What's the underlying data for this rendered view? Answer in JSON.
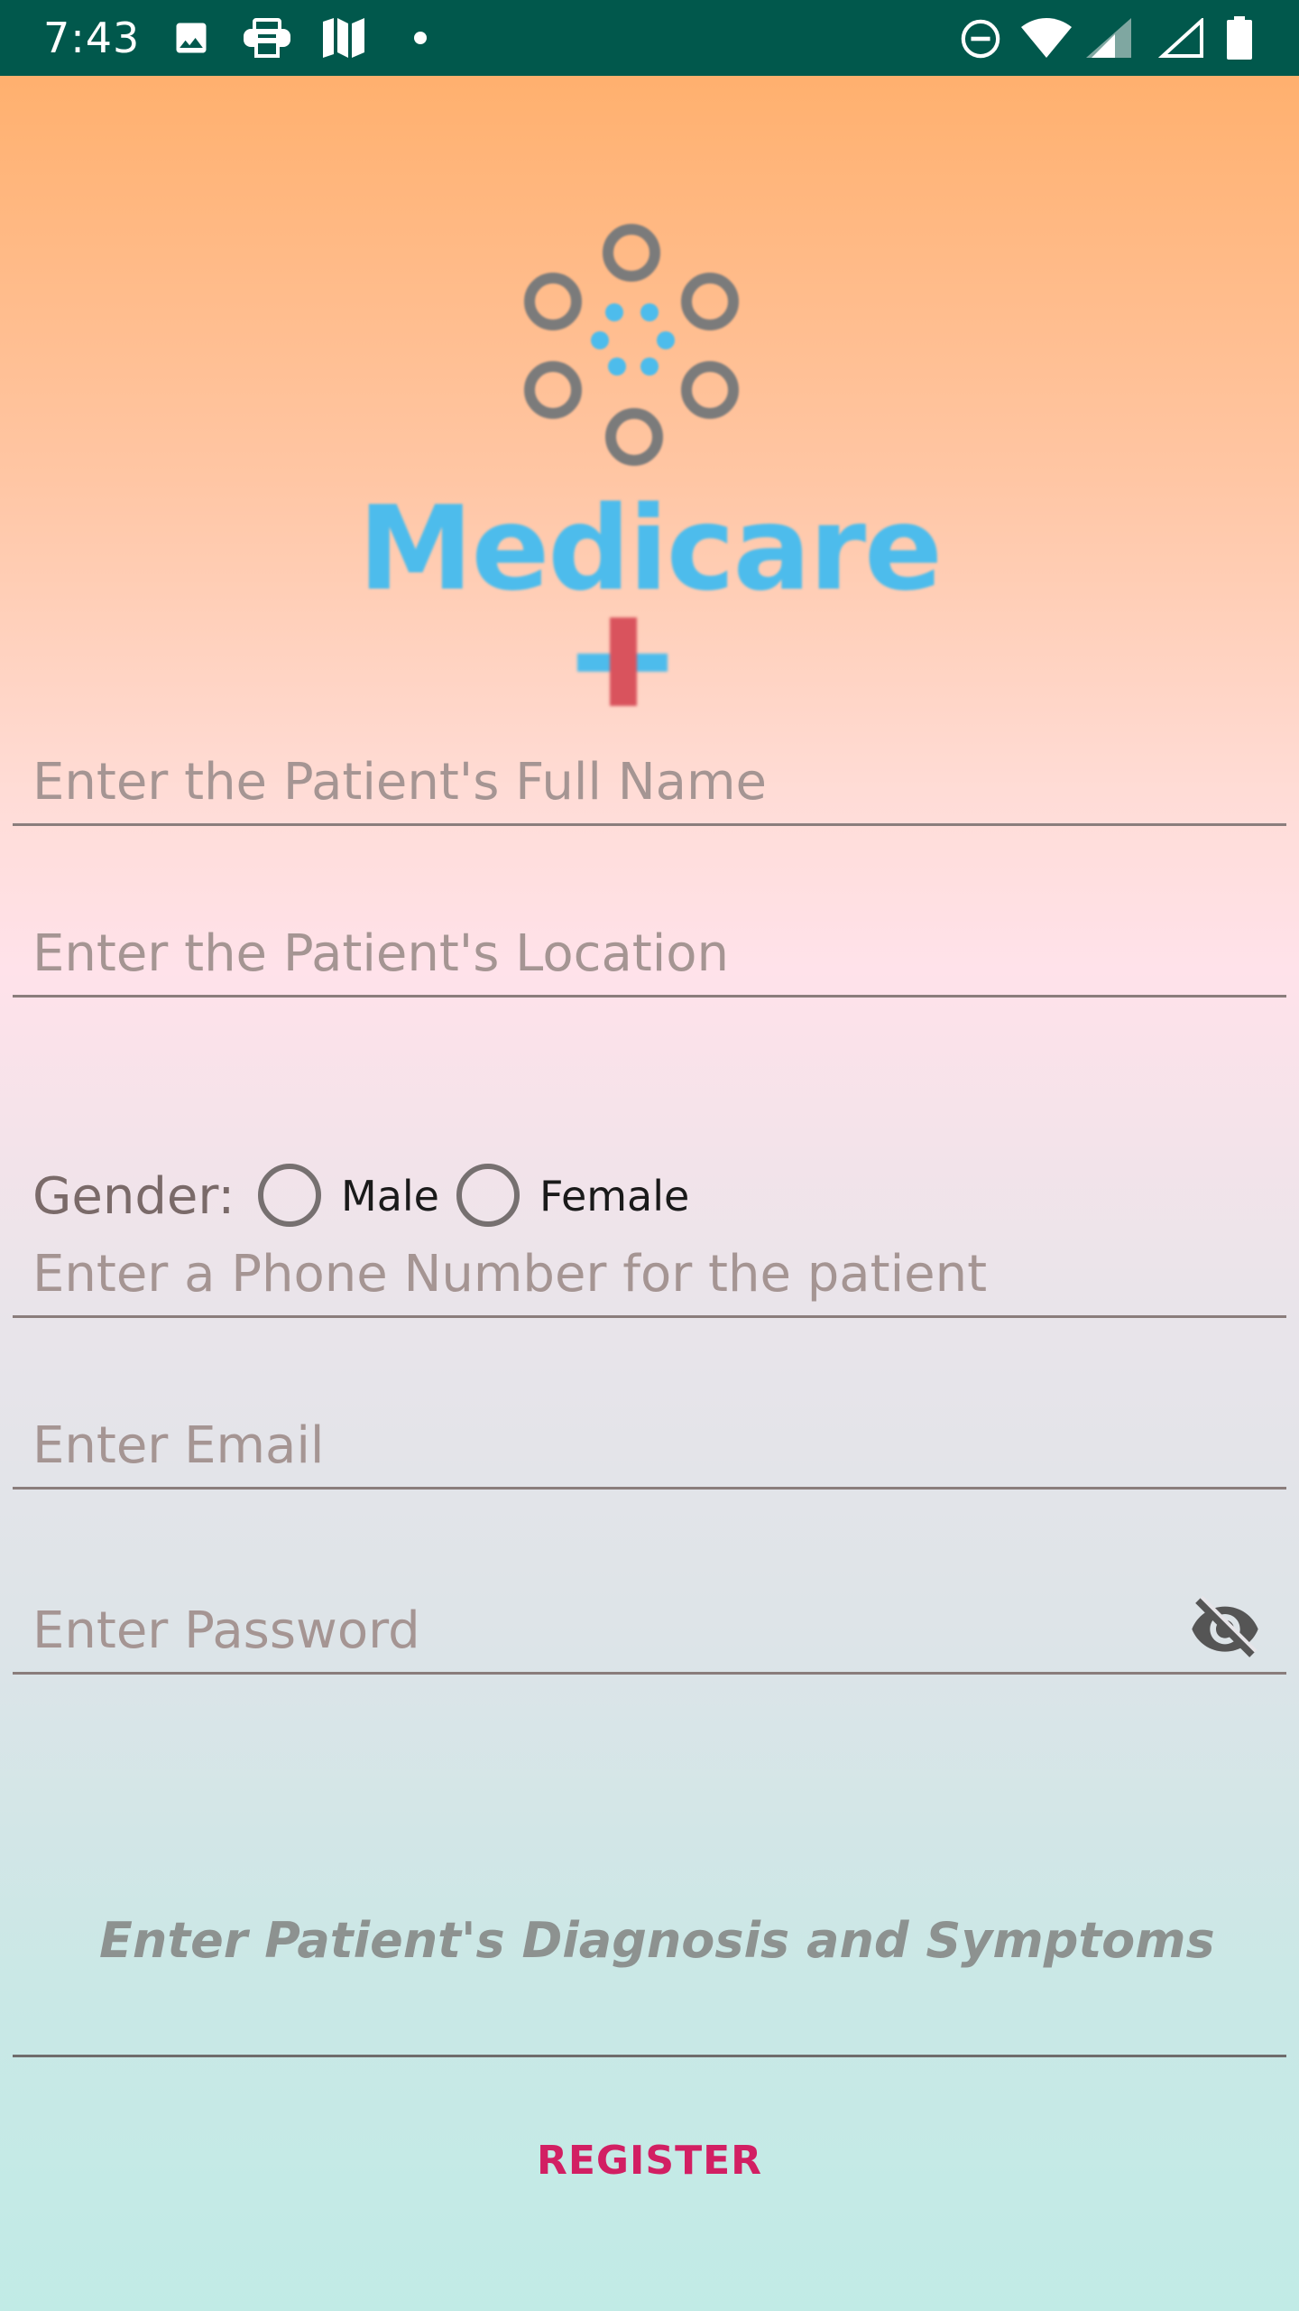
{
  "status_bar": {
    "time": "7:43",
    "icons": [
      "image-icon",
      "printer-icon",
      "maps-icon",
      "dot-icon",
      "do-not-disturb-icon",
      "wifi-icon",
      "signal-icon",
      "signal-empty-icon",
      "battery-icon"
    ]
  },
  "logo": {
    "wordmark": "Medicare",
    "colors": {
      "rings": "#7b7b7b",
      "dots": "#4dbcec",
      "cross_vertical": "#d9535d",
      "cross_horizontal": "#4dbcec"
    }
  },
  "form": {
    "full_name_placeholder": "Enter the Patient's Full Name",
    "location_placeholder": "Enter the Patient's Location",
    "gender": {
      "label": "Gender:",
      "options": [
        "Male",
        "Female"
      ]
    },
    "phone_placeholder": "Enter a Phone Number for the patient",
    "email_placeholder": "Enter Email",
    "password_placeholder": "Enter Password",
    "password_toggle_icon": "eye-off-icon",
    "diagnosis_placeholder": "Enter Patient's Diagnosis and Symptoms",
    "register_label": "REGISTER"
  },
  "theme": {
    "status_bar_color": "#01584c",
    "accent": "#d21f63"
  }
}
